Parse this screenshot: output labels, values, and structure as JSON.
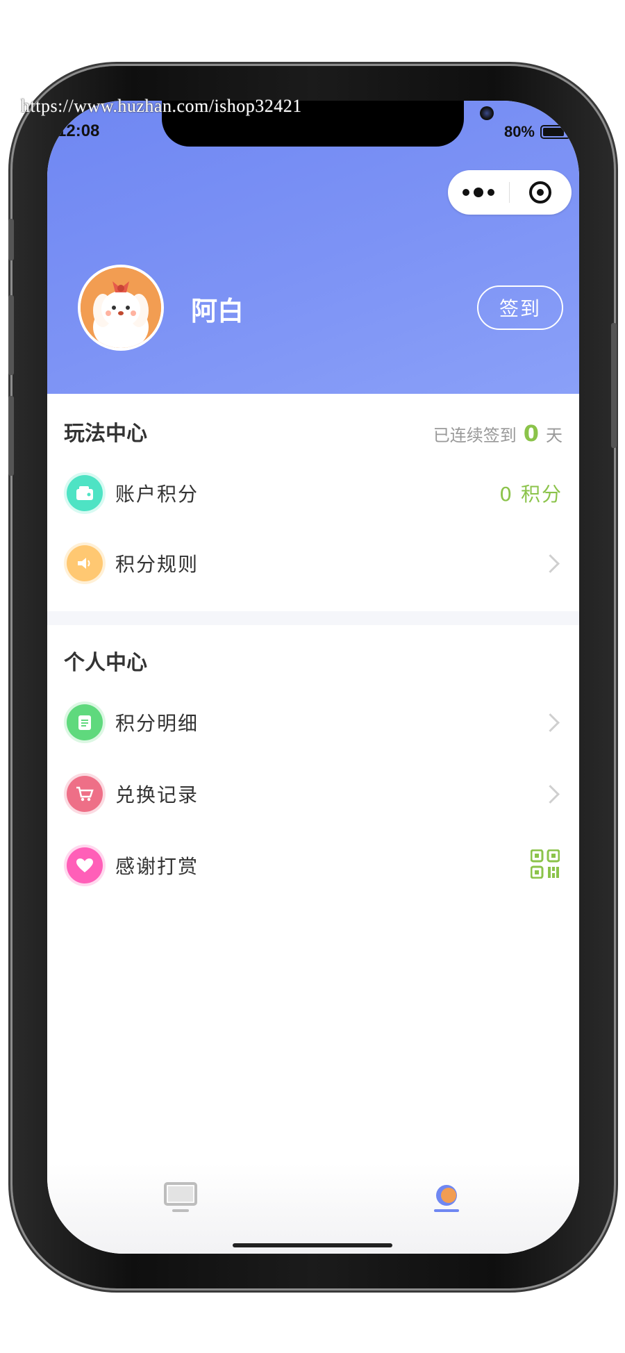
{
  "watermark": "https://www.huzhan.com/ishop32421",
  "status": {
    "time": "12:08",
    "battery": "80%"
  },
  "profile": {
    "name": "阿白",
    "signin_label": "签到"
  },
  "play_center": {
    "title": "玩法中心",
    "streak_prefix": "已连续签到",
    "streak_days": "0",
    "streak_unit": "天",
    "items": [
      {
        "label": "账户积分",
        "value": "0 积分",
        "icon": "wallet-icon",
        "color": "#4ee3c4"
      },
      {
        "label": "积分规则",
        "icon": "speaker-icon",
        "color": "#ffc872"
      }
    ]
  },
  "personal_center": {
    "title": "个人中心",
    "items": [
      {
        "label": "积分明细",
        "icon": "clipboard-icon",
        "color": "#5fd97d"
      },
      {
        "label": "兑换记录",
        "icon": "cart-icon",
        "color": "#ee6f87"
      },
      {
        "label": "感谢打赏",
        "icon": "heart-icon",
        "color": "#ff5fb8",
        "right_icon": "qrcode-icon"
      }
    ]
  },
  "tabbar": {
    "tabs": [
      "home-tab",
      "profile-tab"
    ],
    "active": "profile-tab",
    "accent": "#6f87f2"
  },
  "colors": {
    "header": "#7d93f5",
    "green": "#8bc34a"
  }
}
